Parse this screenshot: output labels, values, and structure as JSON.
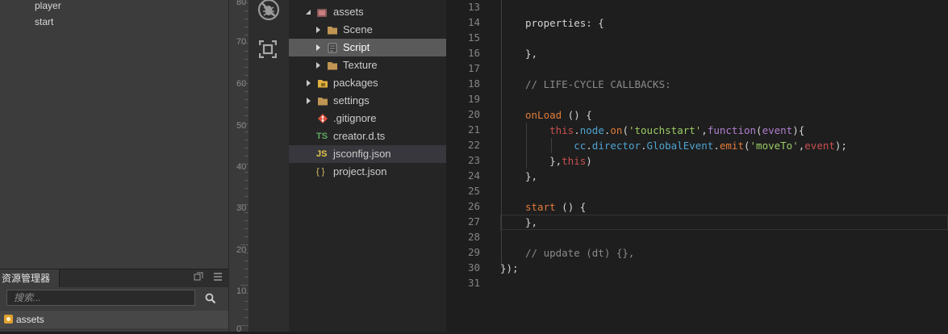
{
  "hierarchy": {
    "nodes": [
      "player",
      "start"
    ]
  },
  "asset_panel": {
    "tab_label": "资源管理器",
    "search_placeholder": "搜索...",
    "root_label": "assets"
  },
  "ruler": {
    "labels": [
      "80",
      "70",
      "60",
      "50",
      "40",
      "30",
      "20",
      "10",
      "0"
    ]
  },
  "file_tree": {
    "items": [
      {
        "label": "assets",
        "icon": "assets-db-icon"
      },
      {
        "label": "Scene",
        "icon": "folder-icon"
      },
      {
        "label": "Script",
        "icon": "script-folder-icon"
      },
      {
        "label": "Texture",
        "icon": "folder-icon"
      },
      {
        "label": "packages",
        "icon": "packages-folder-icon"
      },
      {
        "label": "settings",
        "icon": "folder-icon"
      },
      {
        "label": ".gitignore",
        "icon": "git-icon"
      },
      {
        "label": "creator.d.ts",
        "icon": "typescript-icon",
        "badge": "TS"
      },
      {
        "label": "jsconfig.json",
        "icon": "js-icon",
        "badge": "JS"
      },
      {
        "label": "project.json",
        "icon": "json-icon",
        "badge": "{ }"
      }
    ]
  },
  "editor": {
    "line_numbers": [
      "13",
      "14",
      "15",
      "16",
      "17",
      "18",
      "19",
      "20",
      "21",
      "22",
      "23",
      "24",
      "25",
      "26",
      "27",
      "28",
      "29",
      "30",
      "31"
    ],
    "lines": [
      [],
      [
        {
          "t": "properties: {",
          "c": "c-plain"
        }
      ],
      [],
      [
        {
          "t": "},",
          "c": "c-plain"
        }
      ],
      [],
      [
        {
          "t": "// LIFE-CYCLE CALLBACKS:",
          "c": "c-comment"
        }
      ],
      [],
      [
        {
          "t": "onLoad",
          "c": "c-func"
        },
        {
          "t": " () {",
          "c": "c-plain"
        }
      ],
      [
        {
          "t": "    ",
          "c": "c-plain"
        },
        {
          "t": "this",
          "c": "c-kw"
        },
        {
          "t": ".",
          "c": "c-plain"
        },
        {
          "t": "node",
          "c": "c-prop"
        },
        {
          "t": ".",
          "c": "c-plain"
        },
        {
          "t": "on",
          "c": "c-func"
        },
        {
          "t": "(",
          "c": "c-plain"
        },
        {
          "t": "'touchstart'",
          "c": "c-str"
        },
        {
          "t": ",",
          "c": "c-plain"
        },
        {
          "t": "function",
          "c": "c-purple"
        },
        {
          "t": "(",
          "c": "c-plain"
        },
        {
          "t": "event",
          "c": "c-purple"
        },
        {
          "t": "){",
          "c": "c-plain"
        }
      ],
      [
        {
          "t": "        cc",
          "c": "c-prop"
        },
        {
          "t": ".",
          "c": "c-plain"
        },
        {
          "t": "director",
          "c": "c-prop"
        },
        {
          "t": ".",
          "c": "c-plain"
        },
        {
          "t": "GlobalEvent",
          "c": "c-prop"
        },
        {
          "t": ".",
          "c": "c-plain"
        },
        {
          "t": "emit",
          "c": "c-func"
        },
        {
          "t": "(",
          "c": "c-plain"
        },
        {
          "t": "'moveTo'",
          "c": "c-str"
        },
        {
          "t": ",",
          "c": "c-plain"
        },
        {
          "t": "event",
          "c": "c-kw"
        },
        {
          "t": ");",
          "c": "c-plain"
        }
      ],
      [
        {
          "t": "    },",
          "c": "c-plain"
        },
        {
          "t": "this",
          "c": "c-kw"
        },
        {
          "t": ")",
          "c": "c-plain"
        }
      ],
      [
        {
          "t": "},",
          "c": "c-plain"
        }
      ],
      [],
      [
        {
          "t": "start",
          "c": "c-func"
        },
        {
          "t": " () {",
          "c": "c-plain"
        }
      ],
      [
        {
          "t": "},",
          "c": "c-plain"
        }
      ],
      [],
      [
        {
          "t": "// update (dt) {},",
          "c": "c-comment"
        }
      ],
      [
        {
          "t": "});",
          "c": "c-plain",
          "outdent": true
        }
      ],
      []
    ]
  }
}
